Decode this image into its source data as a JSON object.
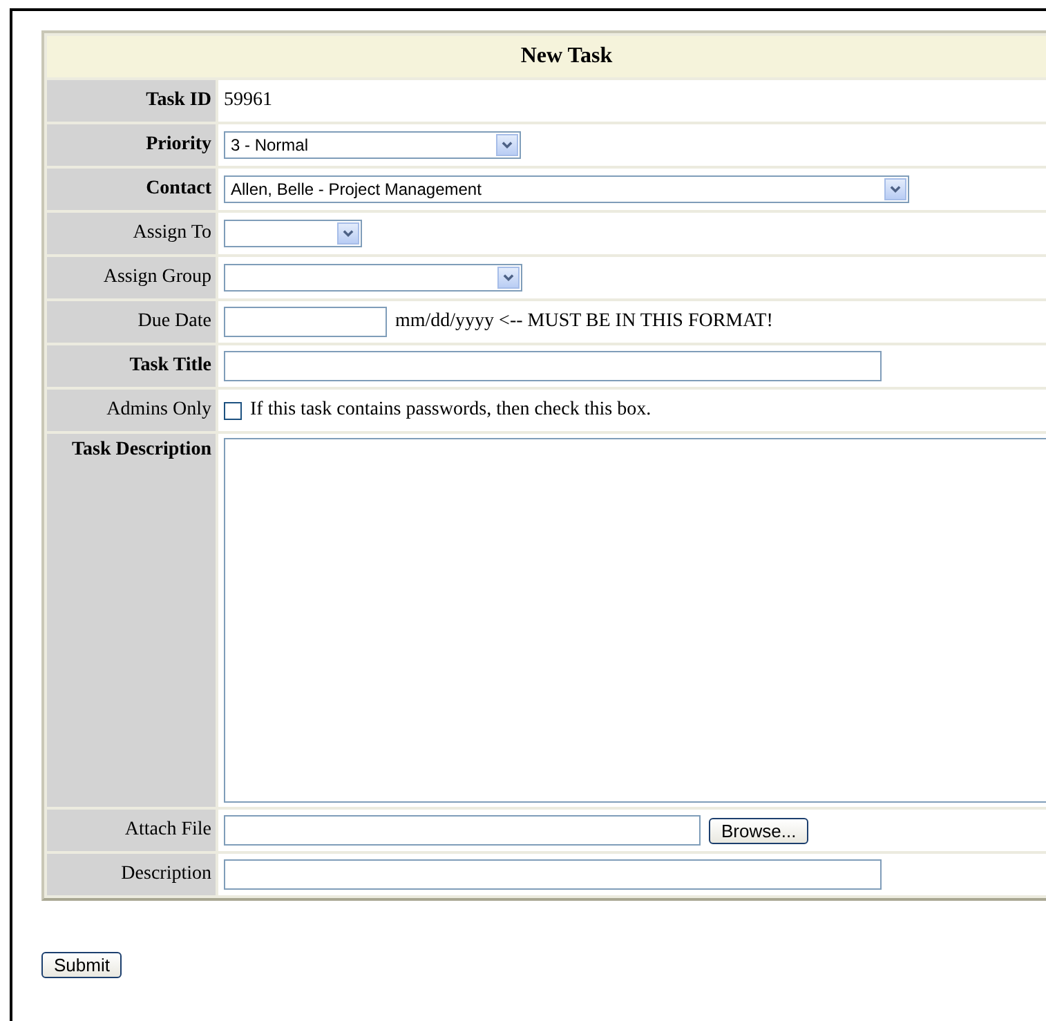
{
  "form": {
    "title": "New Task",
    "rows": [
      {
        "kind": "text",
        "label": "Task ID",
        "emphasized": true,
        "value": "59961"
      },
      {
        "kind": "select",
        "label": "Priority",
        "emphasized": true,
        "value": "3 - Normal"
      },
      {
        "kind": "select",
        "label": "Contact",
        "emphasized": true,
        "value": "Allen, Belle - Project Management"
      },
      {
        "kind": "select",
        "label": "Assign To",
        "emphasized": false
      },
      {
        "kind": "select",
        "label": "Assign Group",
        "emphasized": false
      },
      {
        "kind": "input",
        "label": "Due Date",
        "emphasized": false,
        "note": "mm/dd/yyyy <-- MUST BE IN THIS FORMAT!"
      },
      {
        "kind": "input",
        "label": "Task Title",
        "emphasized": true
      },
      {
        "kind": "checkbox",
        "label": "Admins Only",
        "emphasized": false,
        "checked": false,
        "note": "If this task contains passwords, then check this box."
      },
      {
        "kind": "textarea",
        "label": "Task Description",
        "emphasized": true
      },
      {
        "kind": "file",
        "label": "Attach File",
        "emphasized": false,
        "button": "Browse..."
      },
      {
        "kind": "input",
        "label": "Description",
        "emphasized": false
      }
    ]
  },
  "submit": "Submit"
}
